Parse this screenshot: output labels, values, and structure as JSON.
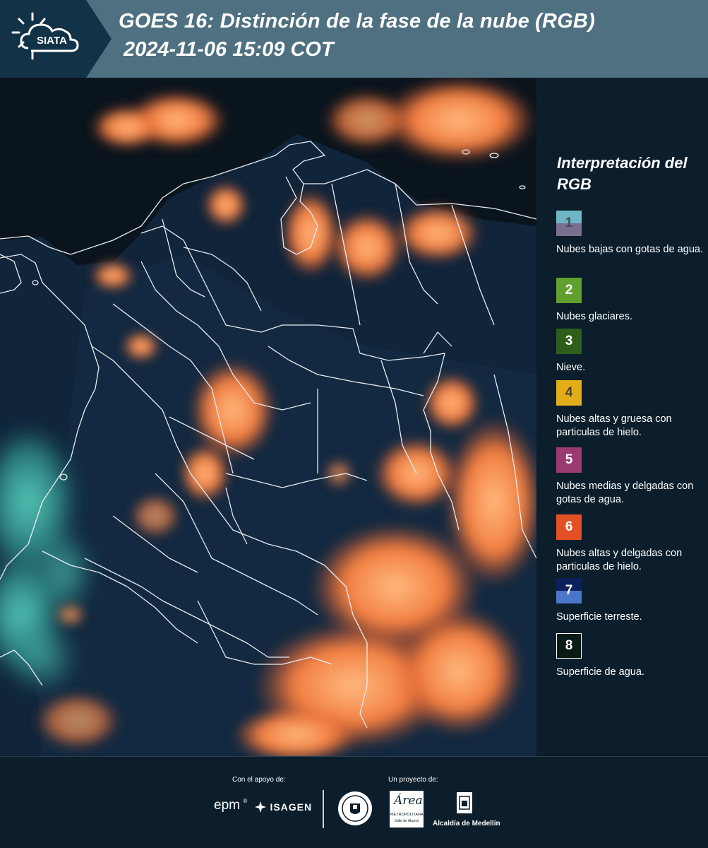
{
  "header": {
    "logo_text": "SIATA",
    "title_line1": "GOES 16: Distinción de la fase de la nube (RGB)",
    "title_line2": "2024-11-06 15:09 COT",
    "bg_color": "#4e7080"
  },
  "map": {
    "description_icon": "satellite-map",
    "colors": {
      "ocean": "#0b1620",
      "land_dark": "#10253a",
      "cloud_orange": "#f07a3c",
      "cloud_light": "#f7a56a",
      "low_cloud_cyan": "#4fc4b4",
      "border": "#e8ecf0"
    }
  },
  "legend": {
    "title": "Interpretación del RGB",
    "items": [
      {
        "number": "1",
        "label": "Nubes bajas con gotas de agua.",
        "color_top": "#6fb6c4",
        "color_bottom": "#7a6f8f",
        "num_color": "#4a4a55"
      },
      {
        "number": "2",
        "label": "Nubes glaciares.",
        "color_top": "#5fa02e",
        "color_bottom": "#5fa02e",
        "num_color": "#ffffff"
      },
      {
        "number": "3",
        "label": "Nieve.",
        "color_top": "#2e5e1c",
        "color_bottom": "#2e5e1c",
        "num_color": "#ffffff"
      },
      {
        "number": "4",
        "label": "Nubes altas y gruesa con particulas de hielo.",
        "color_top": "#e3ac19",
        "color_bottom": "#e3ac19",
        "num_color": "#4a4030"
      },
      {
        "number": "5",
        "label": "Nubes medias y delgadas con gotas de agua.",
        "color_top": "#9a3a73",
        "color_bottom": "#9a3a73",
        "num_color": "#ffffff"
      },
      {
        "number": "6",
        "label": "Nubes altas y delgadas con particulas de hielo.",
        "color_top": "#e45025",
        "color_bottom": "#e45025",
        "num_color": "#ffffff"
      },
      {
        "number": "7",
        "label": "Superficie terreste.",
        "color_top": "#0d1f5c",
        "color_bottom": "#4a77c7",
        "num_color": "#ffffff"
      },
      {
        "number": "8",
        "label": "Superficie de agua.",
        "color_top": "#0a1a14",
        "color_bottom": "#0a1a14",
        "num_color": "#ffffff"
      }
    ]
  },
  "footer": {
    "support_caption": "Con el apoyo de:",
    "project_caption": "Un proyecto de:",
    "epm_text": "epm",
    "isagen_text": "ISAGEN",
    "metropolitana_text": "METROPOLITANA",
    "metropolitana_sub": "Valle de Aburrá",
    "area_script": "Área",
    "alcaldia_text": "Alcaldía de Medellín"
  }
}
